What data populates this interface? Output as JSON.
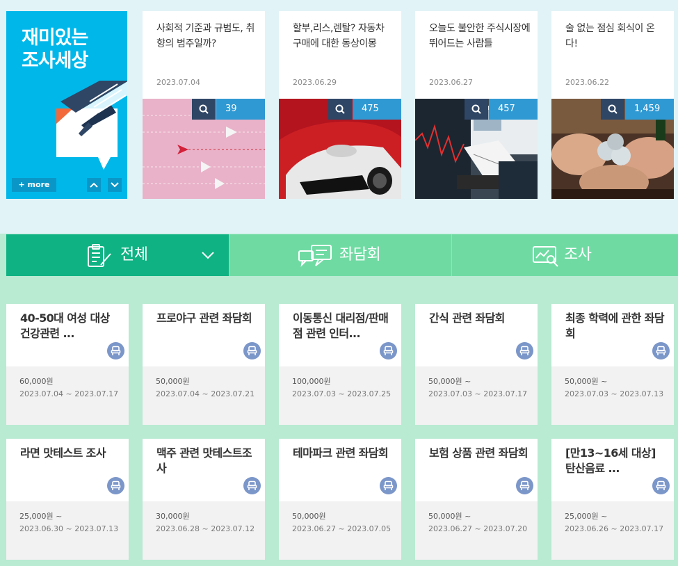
{
  "promo": {
    "title": "재미있는\n조사세상",
    "more_label": "+ more"
  },
  "articles": [
    {
      "title": "사회적 기준과 규범도, 취향의 범주일까?",
      "date": "2023.07.04",
      "count": "39"
    },
    {
      "title": "할부,리스,렌탈? 자동차 구매에 대한 동상이몽",
      "date": "2023.06.29",
      "count": "475"
    },
    {
      "title": "오늘도 불안한 주식시장에 뛰어드는 사람들",
      "date": "2023.06.27",
      "count": "457"
    },
    {
      "title": "술 없는 점심 회식이 온다!",
      "date": "2023.06.22",
      "count": "1,459"
    }
  ],
  "tabs": [
    {
      "label": "전체",
      "icon": "clipboard-icon",
      "active": true
    },
    {
      "label": "좌담회",
      "icon": "chat-bubbles-icon",
      "active": false
    },
    {
      "label": "조사",
      "icon": "chart-search-icon",
      "active": false
    }
  ],
  "cards": [
    {
      "title": "40-50대 여성 대상 건강관련 ...",
      "price": "60,000원",
      "period": "2023.07.04 ~ 2023.07.17"
    },
    {
      "title": "프로야구 관련 좌담회",
      "price": "50,000원",
      "period": "2023.07.04 ~ 2023.07.21"
    },
    {
      "title": "이동통신 대리점/판매점 관련 인터...",
      "price": "100,000원",
      "period": "2023.07.03 ~ 2023.07.25"
    },
    {
      "title": "간식 관련 좌담회",
      "price": "50,000원 ~",
      "period": "2023.07.03 ~ 2023.07.17"
    },
    {
      "title": "최종 학력에 관한 좌담회",
      "price": "50,000원 ~",
      "period": "2023.07.03 ~ 2023.07.13"
    },
    {
      "title": "라면 맛테스트 조사",
      "price": "25,000원 ~",
      "period": "2023.06.30 ~ 2023.07.13"
    },
    {
      "title": "맥주 관련 맛테스트조사",
      "price": "30,000원",
      "period": "2023.06.28 ~ 2023.07.12"
    },
    {
      "title": "테마파크 관련 좌담회",
      "price": "50,000원",
      "period": "2023.06.27 ~ 2023.07.05"
    },
    {
      "title": "보험 상품 관련 좌담회",
      "price": "50,000원 ~",
      "period": "2023.06.27 ~ 2023.07.20"
    },
    {
      "title": "[만13~16세 대상] 탄산음료 ...",
      "price": "25,000원 ~",
      "period": "2023.06.26 ~ 2023.07.17"
    }
  ],
  "colors": {
    "promo_bg": "#00b7ea",
    "tab_active": "#0fb383",
    "tab_inactive": "#6fdba3",
    "count_bg": "#2f99d3",
    "search_bg": "#2f4665",
    "badge": "#7b96c9"
  }
}
